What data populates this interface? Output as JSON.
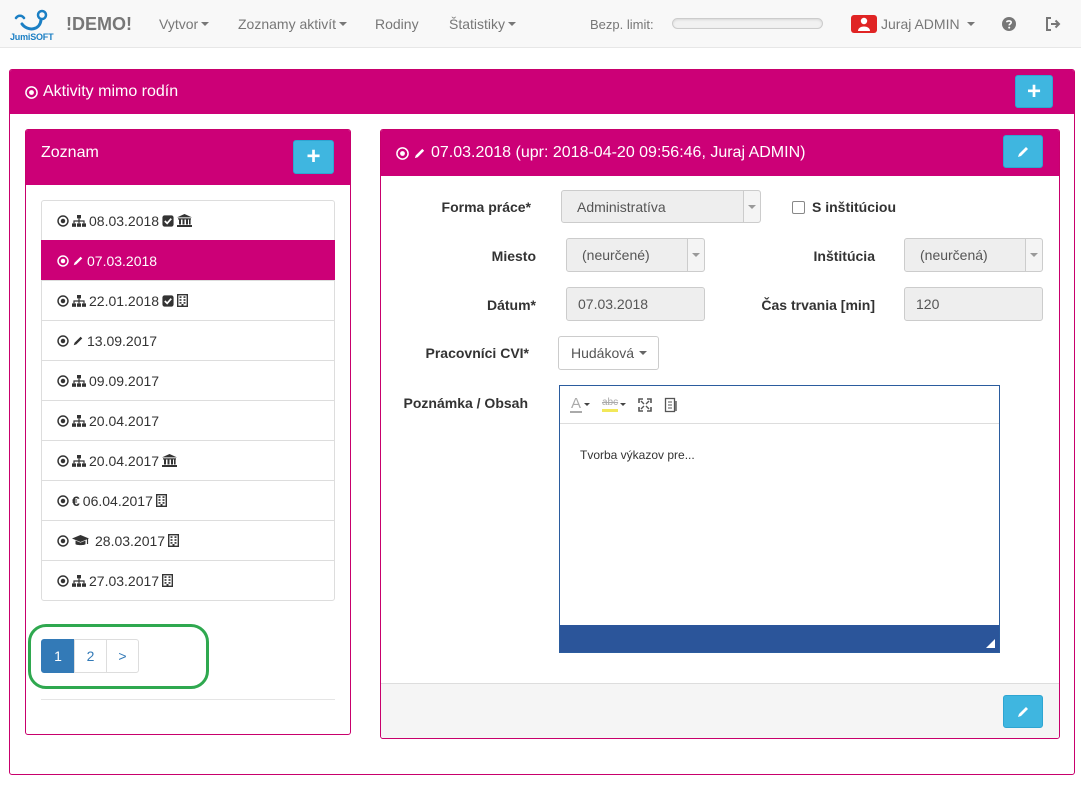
{
  "navbar": {
    "logo_text": "JumiSOFT",
    "brand": "!DEMO!",
    "menu": [
      {
        "label": "Vytvor",
        "dropdown": true
      },
      {
        "label": "Zoznamy aktivít",
        "dropdown": true
      },
      {
        "label": "Rodiny",
        "dropdown": false
      },
      {
        "label": "Štatistiky",
        "dropdown": true
      }
    ],
    "limit_label": "Bezp. limit:",
    "limit_progress": 0,
    "user_name": "Juraj ADMIN"
  },
  "outer_panel": {
    "title": "Aktivity mimo rodín"
  },
  "list_panel": {
    "title": "Zoznam",
    "items": [
      {
        "date": "08.03.2018",
        "icons": [
          "sitemap-icon"
        ],
        "suffix": [
          "check-square-icon",
          "institution-icon"
        ],
        "active": false
      },
      {
        "date": "07.03.2018",
        "icons": [
          "pencil-icon"
        ],
        "suffix": [],
        "active": true
      },
      {
        "date": "22.01.2018",
        "icons": [
          "sitemap-icon"
        ],
        "suffix": [
          "check-square-icon",
          "building-icon"
        ],
        "active": false
      },
      {
        "date": "13.09.2017",
        "icons": [
          "pencil-icon"
        ],
        "suffix": [],
        "active": false
      },
      {
        "date": "09.09.2017",
        "icons": [
          "sitemap-icon"
        ],
        "suffix": [],
        "active": false
      },
      {
        "date": "20.04.2017",
        "icons": [
          "sitemap-icon"
        ],
        "suffix": [],
        "active": false
      },
      {
        "date": "20.04.2017",
        "icons": [
          "sitemap-icon"
        ],
        "suffix": [
          "institution-icon"
        ],
        "active": false
      },
      {
        "date": "06.04.2017",
        "icons": [
          "euro-icon"
        ],
        "suffix": [
          "building-icon"
        ],
        "active": false
      },
      {
        "date": "28.03.2017",
        "icons": [
          "graduation-cap-icon"
        ],
        "suffix": [
          "building-icon"
        ],
        "active": false
      },
      {
        "date": "27.03.2017",
        "icons": [
          "sitemap-icon"
        ],
        "suffix": [
          "building-icon"
        ],
        "active": false
      }
    ],
    "pages": [
      "1",
      "2",
      ">"
    ],
    "active_page": "1"
  },
  "detail_panel": {
    "title": "07.03.2018 (upr: 2018-04-20 09:56:46, Juraj ADMIN)",
    "form": {
      "forma_prace_label": "Forma práce*",
      "forma_prace_value": "Administratíva",
      "s_instituciou_label": "S inštitúciou",
      "s_instituciou_checked": false,
      "miesto_label": "Miesto",
      "miesto_value": "(neurčené)",
      "institucia_label": "Inštitúcia",
      "institucia_value": "(neurčená)",
      "datum_label": "Dátum*",
      "datum_value": "07.03.2018",
      "cas_label": "Čas trvania [min]",
      "cas_value": "120",
      "pracovnici_label": "Pracovníci CVI*",
      "pracovnici_value": "Hudáková",
      "poznamka_label": "Poznámka / Obsah",
      "poznamka_text": "Tvorba výkazov pre...",
      "toolbar_font_glyph": "A",
      "toolbar_spell_glyph": "abc"
    }
  }
}
